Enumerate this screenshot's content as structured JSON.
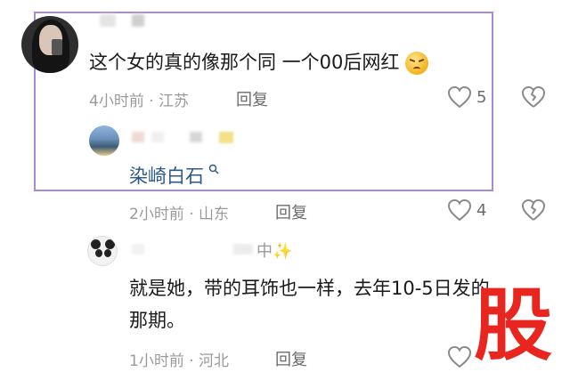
{
  "comment_main": {
    "text": "这个女的真的像那个同 一个00后网红",
    "emoji": "angry-face-icon",
    "meta": "4小时前 · 江苏",
    "reply_label": "回复",
    "like_count": "5"
  },
  "reply_1": {
    "mention": "染崎白石",
    "meta": "2小时前 · 山东",
    "reply_label": "回复",
    "like_count": "4"
  },
  "reply_2": {
    "name_suffix": "中✨",
    "text_line1": "就是她，带的耳饰也一样，去年10-5日发的",
    "text_line2": "那期。",
    "meta": "1小时前 · 河北",
    "reply_label": "回复"
  },
  "watermark": "股",
  "colors": {
    "highlight": "#a98ad8",
    "mention": "#2c5a8c",
    "watermark": "#e8261f"
  }
}
